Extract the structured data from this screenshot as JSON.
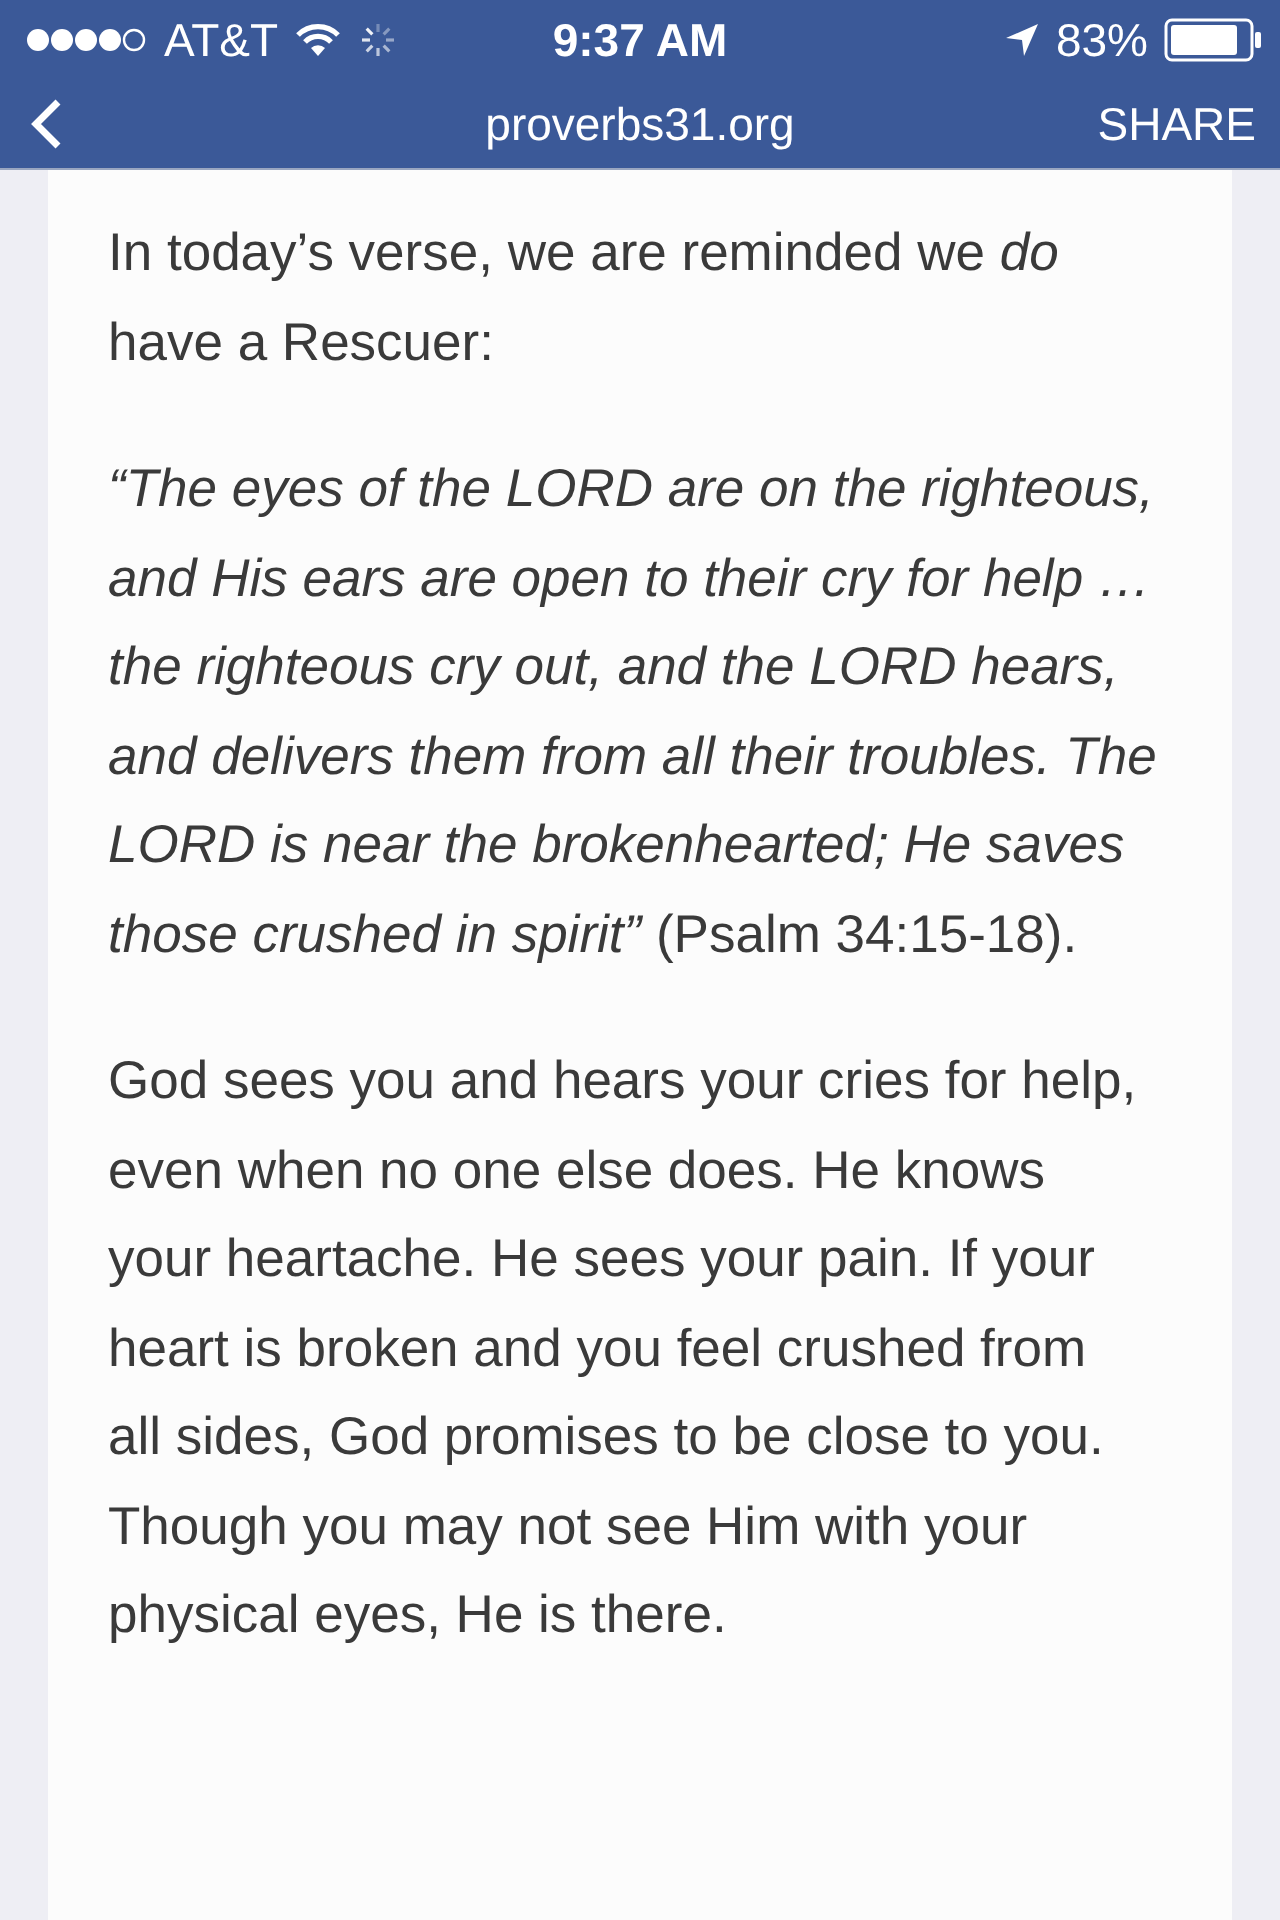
{
  "status_bar": {
    "carrier": "AT&T",
    "time": "9:37 AM",
    "battery": "83%"
  },
  "nav_bar": {
    "title": "proverbs31.org",
    "action": "SHARE"
  },
  "article": {
    "paragraphs": [
      {
        "kind": "plain",
        "text": "In today’s verse, we are reminded we *do* have a Rescuer:"
      },
      {
        "kind": "quote",
        "text": "*“The eyes of the LORD are on the righteous, and His ears are open to their cry for help … the righteous cry out, and the LORD hears, and delivers them from all their troubles. The LORD is near the brokenhearted; He saves those crushed in spirit”* (Psalm 34:15-18)."
      },
      {
        "kind": "plain",
        "text": "God sees you and hears your cries for help, even when no one else does. He knows your heartache. He sees your pain. If your heart is broken and you feel crushed from all sides, God promises to be close to you. Though you may not see Him with your physical eyes, He is there."
      }
    ]
  }
}
